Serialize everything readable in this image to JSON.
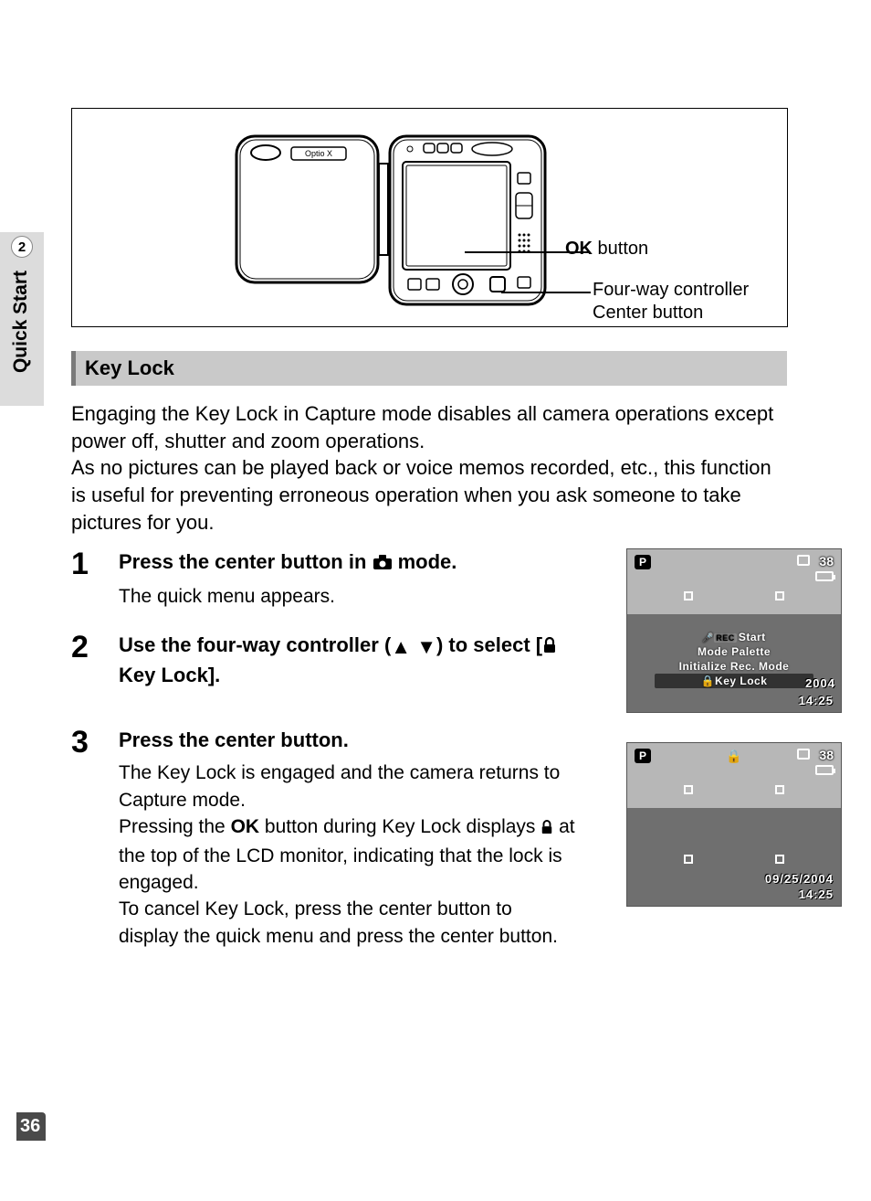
{
  "sidebar": {
    "chapter_num": "2",
    "chapter_title": "Quick Start"
  },
  "page_number": "36",
  "diagram": {
    "camera_label": "Optio X",
    "callout_ok_bold": "OK",
    "callout_ok_rest": " button",
    "callout_4way_line1": "Four-way controller",
    "callout_4way_line2": "Center button"
  },
  "section_heading": "Key Lock",
  "intro_p1": "Engaging the Key Lock in Capture mode disables all camera operations except power off, shutter and zoom operations.",
  "intro_p2": "As no pictures can be played back or voice memos recorded, etc., this function is useful for preventing erroneous operation when you ask someone to take pictures for you.",
  "steps": {
    "s1": {
      "num": "1",
      "title_a": "Press the center button in ",
      "title_b": " mode.",
      "desc": "The quick menu appears."
    },
    "s2": {
      "num": "2",
      "title_a": "Use the four-way controller (",
      "title_b": ") to select [",
      "title_c": " Key Lock]."
    },
    "s3": {
      "num": "3",
      "title": "Press the center button.",
      "desc_a": "The Key Lock is engaged and the camera returns to Capture mode.",
      "desc_b1": "Pressing the ",
      "desc_b_ok": "OK",
      "desc_b2": " button during Key Lock displays ",
      "desc_b3": " at the top of the LCD monitor, indicating that the lock is engaged.",
      "desc_c": "To cancel Key Lock, press the center button to display the quick menu and press the center button."
    }
  },
  "lcd1": {
    "mode": "P",
    "shots": "38",
    "menu": {
      "row1_pre": "🎤",
      "row1_rec": "REC",
      "row1_label": "Start",
      "row2": "Mode Palette",
      "row3": "Initialize Rec. Mode",
      "row4_icon": "🔒",
      "row4_label": "Key Lock"
    },
    "year": "2004",
    "time": "14:25"
  },
  "lcd2": {
    "mode": "P",
    "shots": "38",
    "lock_icon": "🔒",
    "date": "09/25/2004",
    "time": "14:25"
  },
  "glyphs": {
    "camera": "📷",
    "up": "▲",
    "down": "▼",
    "lock": "🔒"
  }
}
